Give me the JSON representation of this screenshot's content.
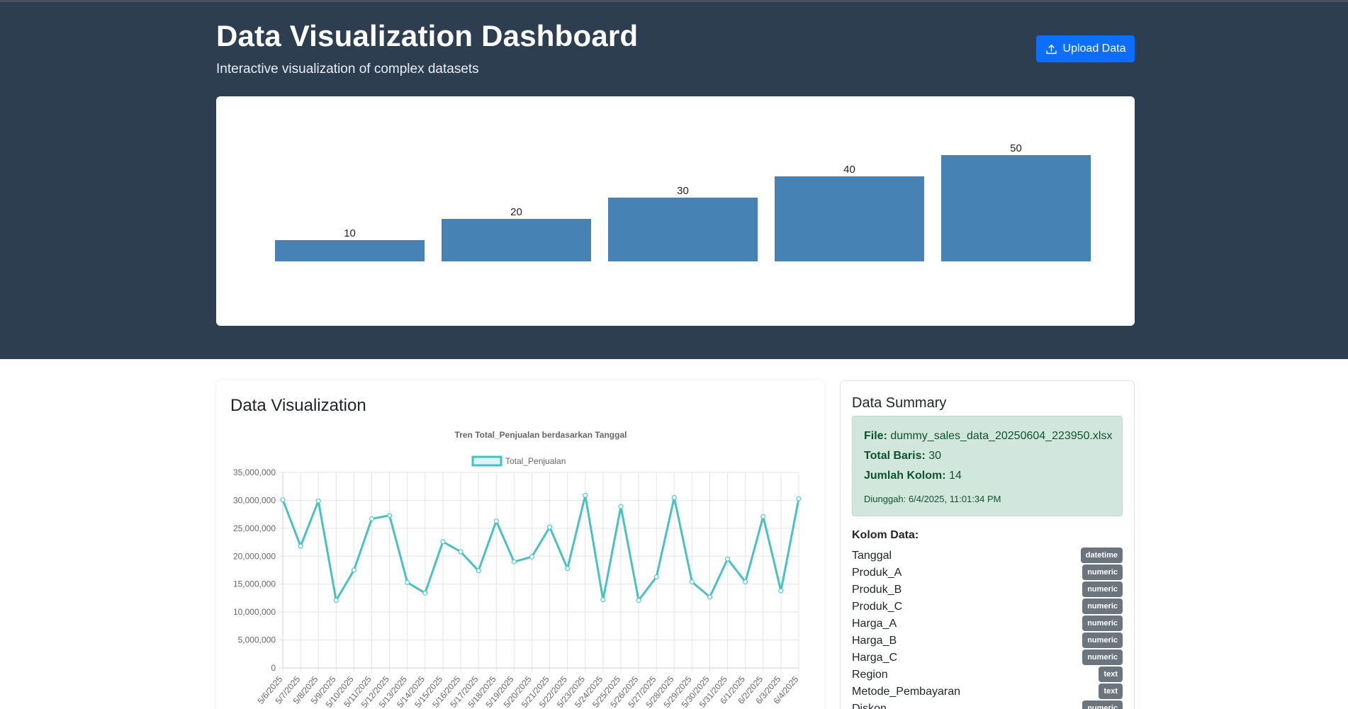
{
  "header": {
    "title": "Data Visualization Dashboard",
    "subtitle": "Interactive visualization of complex datasets",
    "upload_label": "Upload Data",
    "upload_icon": "upload-icon"
  },
  "colors": {
    "hero_bg": "#2e3e51",
    "bar": "#4682b4",
    "line": "#4bc0c0",
    "button": "#0d6efd",
    "badge": "#6c757d",
    "info_bg": "#d1e7dd"
  },
  "visualization": {
    "title": "Data Visualization"
  },
  "summary": {
    "title": "Data Summary",
    "file_label": "File:",
    "file_value": "dummy_sales_data_20250604_223950.xlsx",
    "rows_label": "Total Baris:",
    "rows_value": "30",
    "cols_label": "Jumlah Kolom:",
    "cols_value": "14",
    "uploaded": "Diunggah: 6/4/2025, 11:01:34 PM",
    "columns_heading": "Kolom Data:",
    "columns": [
      {
        "name": "Tanggal",
        "type": "datetime"
      },
      {
        "name": "Produk_A",
        "type": "numeric"
      },
      {
        "name": "Produk_B",
        "type": "numeric"
      },
      {
        "name": "Produk_C",
        "type": "numeric"
      },
      {
        "name": "Harga_A",
        "type": "numeric"
      },
      {
        "name": "Harga_B",
        "type": "numeric"
      },
      {
        "name": "Harga_C",
        "type": "numeric"
      },
      {
        "name": "Region",
        "type": "text"
      },
      {
        "name": "Metode_Pembayaran",
        "type": "text"
      },
      {
        "name": "Diskon",
        "type": "numeric"
      }
    ]
  },
  "chart_data": [
    {
      "type": "bar",
      "categories": [
        "",
        "",
        "",
        "",
        ""
      ],
      "values": [
        10,
        20,
        30,
        40,
        50
      ],
      "data_labels": [
        "10",
        "20",
        "30",
        "40",
        "50"
      ],
      "title": "",
      "grid": false,
      "legend": "none"
    },
    {
      "type": "line",
      "title": "Tren Total_Penjualan berdasarkan Tanggal",
      "legend_position": "top",
      "grid": true,
      "ylim": [
        0,
        35000000
      ],
      "yticks": [
        "0",
        "5,000,000",
        "10,000,000",
        "15,000,000",
        "20,000,000",
        "25,000,000",
        "30,000,000",
        "35,000,000"
      ],
      "x": [
        "5/6/2025",
        "5/7/2025",
        "5/8/2025",
        "5/9/2025",
        "5/10/2025",
        "5/11/2025",
        "5/12/2025",
        "5/13/2025",
        "5/14/2025",
        "5/15/2025",
        "5/16/2025",
        "5/17/2025",
        "5/18/2025",
        "5/19/2025",
        "5/20/2025",
        "5/21/2025",
        "5/22/2025",
        "5/23/2025",
        "5/24/2025",
        "5/25/2025",
        "5/26/2025",
        "5/27/2025",
        "5/28/2025",
        "5/29/2025",
        "5/30/2025",
        "5/31/2025",
        "6/1/2025",
        "6/2/2025",
        "6/3/2025",
        "6/4/2025"
      ],
      "series": [
        {
          "name": "Total_Penjualan",
          "values": [
            30100000,
            21800000,
            29900000,
            12100000,
            17500000,
            26700000,
            27300000,
            15300000,
            13400000,
            22600000,
            20800000,
            17400000,
            26300000,
            19000000,
            19900000,
            25200000,
            17800000,
            30900000,
            12200000,
            28900000,
            12100000,
            16300000,
            30500000,
            15400000,
            12700000,
            19500000,
            15400000,
            27100000,
            13800000,
            30300000
          ]
        }
      ]
    }
  ]
}
